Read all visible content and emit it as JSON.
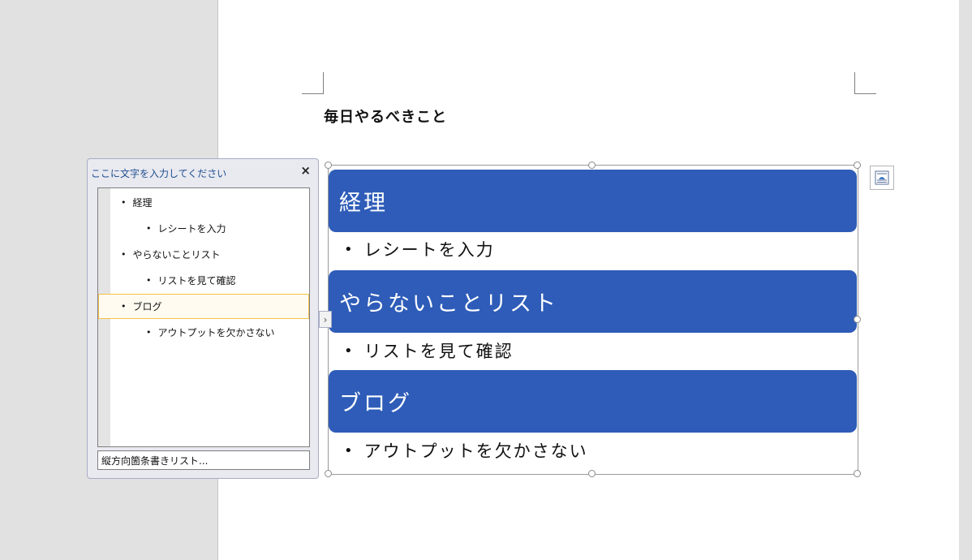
{
  "document": {
    "title": "毎日やるべきこと"
  },
  "smartart": {
    "headers": [
      {
        "label": "経理",
        "bullet": "•",
        "item": "レシートを入力"
      },
      {
        "label": "やらないことリスト",
        "bullet": "•",
        "item": "リストを見て確認"
      },
      {
        "label": "ブログ",
        "bullet": "•",
        "item": "アウトプットを欠かさない"
      }
    ],
    "shape_color": "#2e5cb8"
  },
  "text_pane": {
    "title": "ここに文字を入力してください",
    "close_glyph": "×",
    "items": [
      {
        "bullet": "•",
        "text": "経理"
      },
      {
        "bullet": "•",
        "text": "レシートを入力"
      },
      {
        "bullet": "•",
        "text": "やらないことリスト"
      },
      {
        "bullet": "•",
        "text": "リストを見て確認"
      },
      {
        "bullet": "•",
        "text": "ブログ"
      },
      {
        "bullet": "•",
        "text": "アウトプットを欠かさない"
      }
    ],
    "footer": "縦方向箇条書きリスト...",
    "expand_glyph": "›"
  }
}
